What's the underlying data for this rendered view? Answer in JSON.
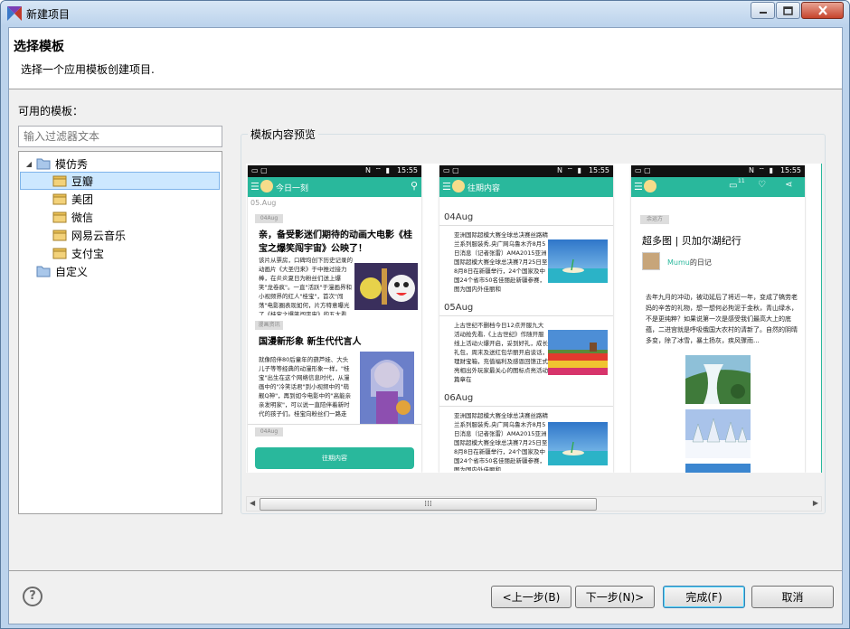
{
  "window": {
    "title": "新建项目",
    "min_icon": "minimize-icon",
    "max_icon": "maximize-icon",
    "close_icon": "close-icon"
  },
  "header": {
    "title": "选择模板",
    "description": "选择一个应用模板创建项目."
  },
  "left": {
    "label": "可用的模板：",
    "filter_placeholder": "输入过滤器文本",
    "tree": [
      {
        "label": "模仿秀",
        "expanded": true,
        "children": [
          "豆瓣",
          "美团",
          "微信",
          "网易云音乐",
          "支付宝"
        ]
      },
      {
        "label": "自定义"
      }
    ],
    "selected": "豆瓣"
  },
  "preview": {
    "legend": "模板内容预览",
    "shots": [
      {
        "status_time": "15:55",
        "bar_title": "今日一刻",
        "sub_date": "05.Aug",
        "tag1": "04Aug",
        "headline1": "亲，备受影迷们期待的动画大电影《桂宝之爆笑闯宇宙》公映了！",
        "para1": "该片从票房，口碑均创下历史记录的动画片《大圣归来》于中推过接力棒，在炎炎夏日为粉丝们送上爆笑\"龙卷疯\"。一直\"活跃\"于漫画界和小视频界的红人\"桂宝\"，首次\"闯荡\"电影圈表现如何，片方特意曝光了《桂宝之爆笑闯宇宙》的五大看点，各个都非常活跃好玩！",
        "tag2": "漫画资讯",
        "headline2": "国漫新形象 新生代代言人",
        "para2": "就像陪伴80后童年的葫芦娃、大头儿子等等经典的动漫形象一样，\"桂宝\"出生在这个网络信息时代，从漫画中的\"冷笑话君\"到小视频中的\"萌靓Q神\"，再到如今电影中的\"高能亲亲发明家\"，可以说一直陪伴着新时代的孩子们。桂宝向粉丝们一路走来，感谢有你们。",
        "tag3": "04Aug",
        "button": "往期内容"
      },
      {
        "status_time": "15:55",
        "bar_title": "往期内容",
        "entries": [
          {
            "date": "04Aug",
            "text": "亚洲国际超模大赛全球总决赛丝路精兰系列服装秀,央广网乌鲁木齐8月5日消息（记者张雷）AMA2015亚洲国际超模大赛全球总决赛7月25日至8月8日在新疆举行，24个国家及中国24个省市50名佳丽赴新疆参赛，图为国内外佳丽和"
          },
          {
            "date": "05Aug",
            "text": "上古世纪不删档今日12点开服九大活动抢先看,《上古世纪》作随开服线上活动火爆开启，妥到好礼，成长礼包，周末及送红包华丽开启谈话，理财宝箱，充值福利及感恩回馈正式亮相出外玩家最关心的图标点亮活动篇章在"
          },
          {
            "date": "06Aug",
            "text": "亚洲国际超模大赛全球总决赛丝路精兰系列服装秀,央广网乌鲁木齐8月5日消息（记者张雷）AMA2015亚洲国际超模大赛全球总决赛7月25日至8月8日在新疆举行，24个国家及中国24个省市50名佳丽赴新疆参赛，图为国内外佳丽和"
          }
        ]
      },
      {
        "status_time": "15:55",
        "bar_count": "11",
        "tag": "余运方",
        "headline": "超多图 | 贝加尔湖纪行",
        "author": "Mumu",
        "author_suffix": "的日记",
        "para": "去年九月的冲动，被动延后了将近一年，变成了犒劳老妈的辛苦的礼物，想一想何必拘泥于金秋，青山绿水，不是更纯粹？如果说第一次是感受我们最高大上的底蕴，二进宫就是呼吸俄国大农村的清新了。自然的阴晴多变，除了冰雪，暴土扬灰，疾风骤雨..."
      }
    ]
  },
  "buttons": {
    "back": "<上一步(B)",
    "next": "下一步(N)>",
    "finish": "完成(F)",
    "cancel": "取消",
    "help_icon": "help-icon"
  }
}
